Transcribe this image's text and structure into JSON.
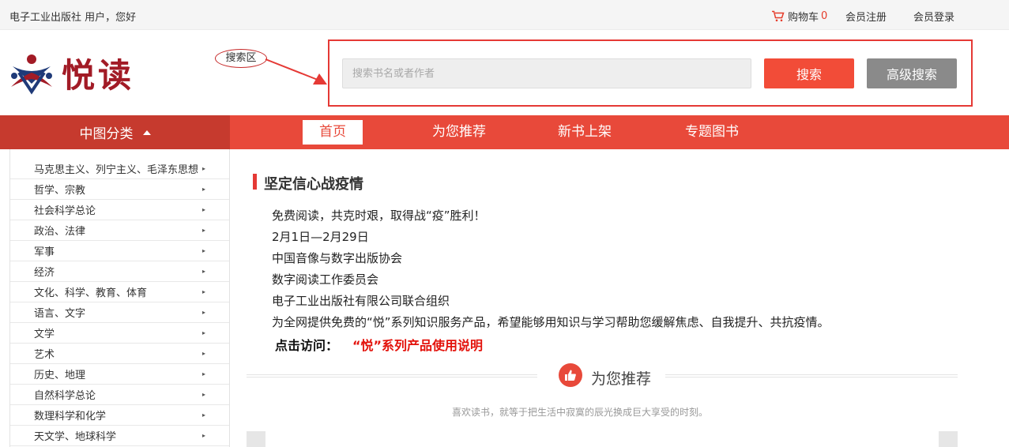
{
  "topbar": {
    "greeting": "电子工业出版社 用户，您好",
    "cart_label": "购物车",
    "cart_count": "0",
    "register": "会员注册",
    "login": "会员登录"
  },
  "header": {
    "logo_text": "悦读",
    "annotation": "搜索区",
    "search_placeholder": "搜索书名或者作者",
    "search_button": "搜索",
    "advanced_search_button": "高级搜索"
  },
  "nav": {
    "category_label": "中图分类",
    "items": [
      {
        "label": "首页",
        "active": true
      },
      {
        "label": "为您推荐",
        "active": false
      },
      {
        "label": "新书上架",
        "active": false
      },
      {
        "label": "专题图书",
        "active": false
      }
    ]
  },
  "sidebar": {
    "items": [
      {
        "label": "马克思主义、列宁主义、毛泽东思想"
      },
      {
        "label": "哲学、宗教"
      },
      {
        "label": "社会科学总论"
      },
      {
        "label": "政治、法律"
      },
      {
        "label": "军事"
      },
      {
        "label": "经济"
      },
      {
        "label": "文化、科学、教育、体育"
      },
      {
        "label": "语言、文字"
      },
      {
        "label": "文学"
      },
      {
        "label": "艺术"
      },
      {
        "label": "历史、地理"
      },
      {
        "label": "自然科学总论"
      },
      {
        "label": "数理科学和化学"
      },
      {
        "label": "天文学、地球科学"
      }
    ]
  },
  "main": {
    "section_title": "坚定信心战疫情",
    "paragraphs": [
      "免费阅读，共克时艰，取得战“疫”胜利！",
      "2月1日—2月29日",
      "中国音像与数字出版协会",
      "数字阅读工作委员会",
      "电子工业出版社有限公司联合组织",
      "为全网提供免费的“悦”系列知识服务产品，希望能够用知识与学习帮助您缓解焦虑、自我提升、共抗疫情。"
    ],
    "visit_label": "点击访问：",
    "visit_link": "“悦”系列产品使用说明",
    "recommend_title": "为您推荐",
    "recommend_subtitle": "喜欢读书，就等于把生活中寂寞的辰光换成巨大享受的时刻。"
  },
  "colors": {
    "accent": "#e8493a",
    "accent_dark": "#c63a2e",
    "logo": "#a21b26",
    "link_red": "#e3120b"
  }
}
